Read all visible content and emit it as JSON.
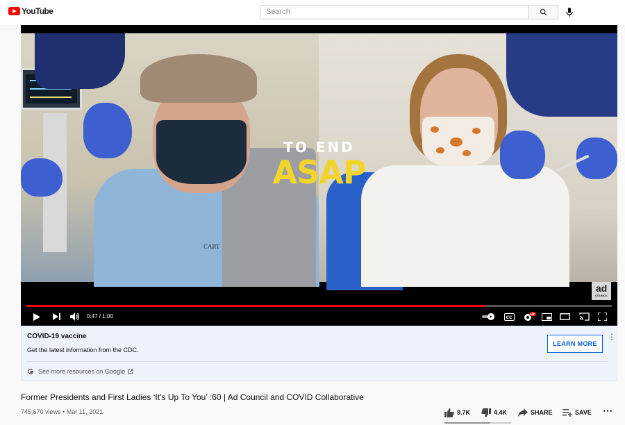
{
  "masthead": {
    "logo_text": "YouTube",
    "search_placeholder": "Search",
    "icons": [
      "search-icon",
      "mic-icon"
    ]
  },
  "video": {
    "overlay_line1": "TO END",
    "overlay_line2": "ASAP",
    "chest_text": "CART",
    "watermark": "ad",
    "watermark_sub": "COUNCIL",
    "time": "0:47 / 1:00",
    "progress": 0.783,
    "controls": [
      "play-icon",
      "next-icon",
      "volume-icon",
      "autoplay-toggle-icon",
      "captions-icon",
      "settings-icon",
      "miniplayer-icon",
      "theater-icon",
      "cast-icon",
      "fullscreen-icon"
    ],
    "settings_badge": "HD",
    "accent": "#ff0000",
    "overlay_color": "#f2d52a"
  },
  "info_panel": {
    "title": "COVID-19 vaccine",
    "subtitle": "Get the latest information from the CDC.",
    "google_link": "See more resources on Google",
    "button": "LEARN MORE"
  },
  "details": {
    "title": "Former Presidents and First Ladies ‘It’s Up To You’ :60 | Ad Council and COVID Collaborative",
    "views": "745,670 views",
    "date": "Mar 11, 2021",
    "separator": "•",
    "likes": "9.7K",
    "dislikes": "4.4K",
    "share_label": "SHARE",
    "save_label": "SAVE",
    "like_ratio": 0.69
  }
}
